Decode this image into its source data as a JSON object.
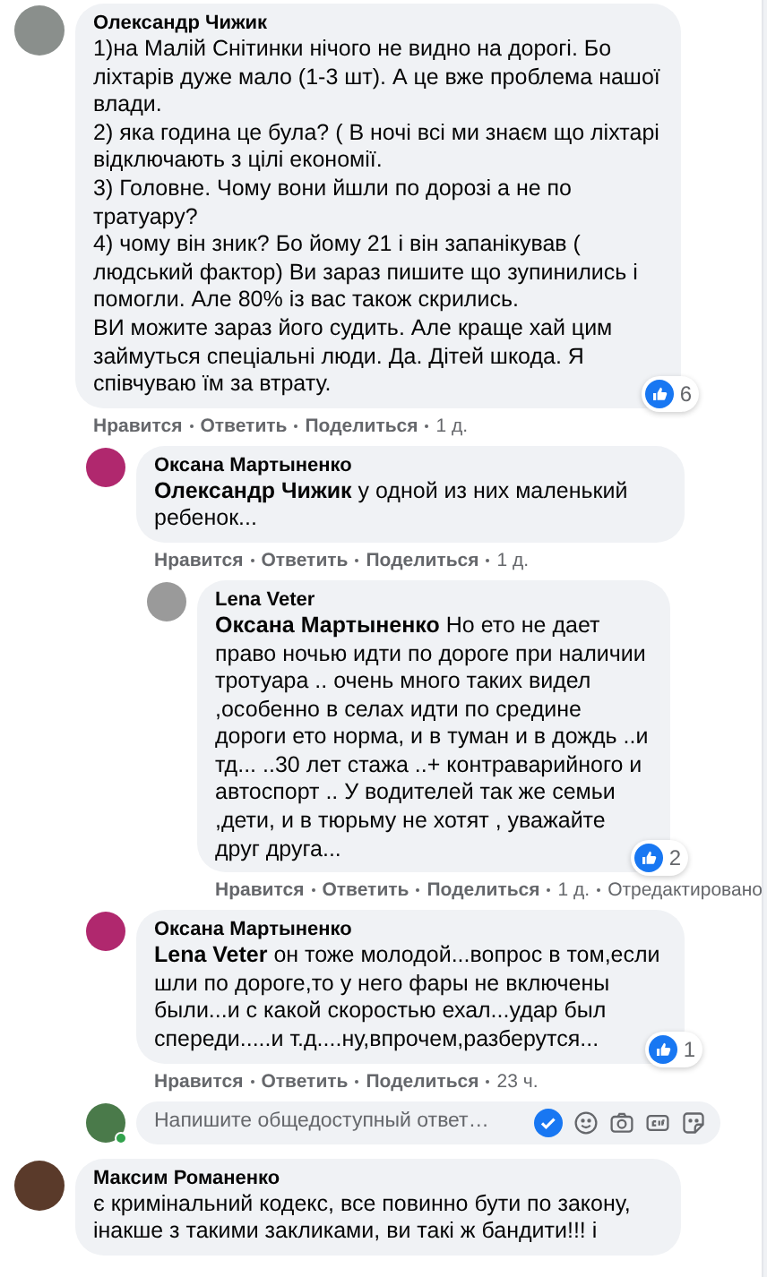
{
  "comments": [
    {
      "author": "Олександр Чижик",
      "color": "#8a8f8c",
      "text": [
        "1)на Малій Снітинки нічого не видно на дорогі. Бо ліхтарів дуже мало (1-3 шт). А це вже проблема нашої влади.",
        "2) яка година це була? ( В ночі всі ми знаєм що ліхтарі відключають з цілі економії.",
        "3) Головне. Чому вони йшли по дорозі а не по тратуару?",
        "4) чому він зник? Бо йому 21 і він запанікував ( людський фактор) Ви зараз пишите що зупинились і помогли. Але 80% із вас також скрились.",
        "ВИ можите зараз його судить. Але краще хай цим займуться спеціальні люди. Да. Дітей шкода. Я співчуваю їм за втрату."
      ],
      "reactions": "6",
      "actions": [
        "Нравится",
        "Ответить",
        "Поделиться"
      ],
      "time": "1 д.",
      "children": [
        {
          "author": "Оксана Мартыненко",
          "color": "#b0286e",
          "text": [
            "**Олександр Чижик** у одной из них маленький ребенок..."
          ],
          "actions": [
            "Нравится",
            "Ответить",
            "Поделиться"
          ],
          "time": "1 д.",
          "children": [
            {
              "author": "Lena Veter",
              "color": "#9a9a9a",
              "text": [
                "**Оксана Мартыненко** Но ето не дает право ночью идти по дороге при наличии тротуара .. очень много таких видел ,особенно в селах идти по средине дороги ето норма, и в туман и в дождь ..и тд... ..30 лет стажа ..+ контраварийного и автоспорт .. У водителей так же семьи ,дети, и в тюрьму не хотят , уважайте друг друга..."
              ],
              "reactions": "2",
              "actions": [
                "Нравится",
                "Ответить",
                "Поделиться"
              ],
              "time": "1 д.",
              "edited": "Отредактировано"
            }
          ]
        },
        {
          "author": "Оксана Мартыненко",
          "color": "#b0286e",
          "text": [
            "**Lena Veter** он тоже молодой...вопрос в том,если шли по дороге,то у него фары не включены были...и с какой скоростью ехал...удар был спереди.....и т.д....ну,впрочем,разберутся..."
          ],
          "reactions": "1",
          "actions": [
            "Нравится",
            "Ответить",
            "Поделиться"
          ],
          "time": "23 ч."
        }
      ],
      "reply_box": {
        "placeholder": "Напишите общедоступный ответ…"
      }
    },
    {
      "author": "Максим Романенко",
      "color": "#5a3a2a",
      "text": [
        "є кримінальний кодекс, все повинно бути по закону, інакше з такими закликами, ви такі ж бандити!!! і"
      ]
    }
  ]
}
